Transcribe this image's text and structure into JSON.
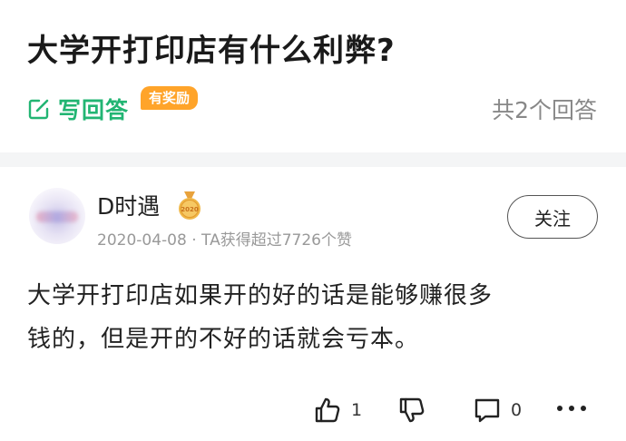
{
  "question": {
    "title": "大学开打印店有什么利弊?",
    "write_answer_label": "写回答",
    "reward_badge": "有奖励",
    "answer_count": "共2个回答"
  },
  "answer": {
    "author": "D时遇",
    "medal_year": "2020",
    "meta": "2020-04-08 · TA获得超过7726个赞",
    "follow_label": "关注",
    "body_line1": "大学开打印店如果开的好的话是能够赚很多",
    "body_line2": "钱的，但是开的不好的话就会亏本。",
    "like_count": "1",
    "comment_count": "0"
  },
  "colors": {
    "accent_green": "#22b573",
    "reward_orange": "#ffa42a",
    "muted_text": "#888888"
  },
  "icons": {
    "write": "edit-square-icon",
    "like": "thumbs-up-icon",
    "dislike": "thumbs-down-icon",
    "comment": "comment-bubble-icon",
    "more": "more-dots-icon",
    "medal": "medal-icon"
  }
}
